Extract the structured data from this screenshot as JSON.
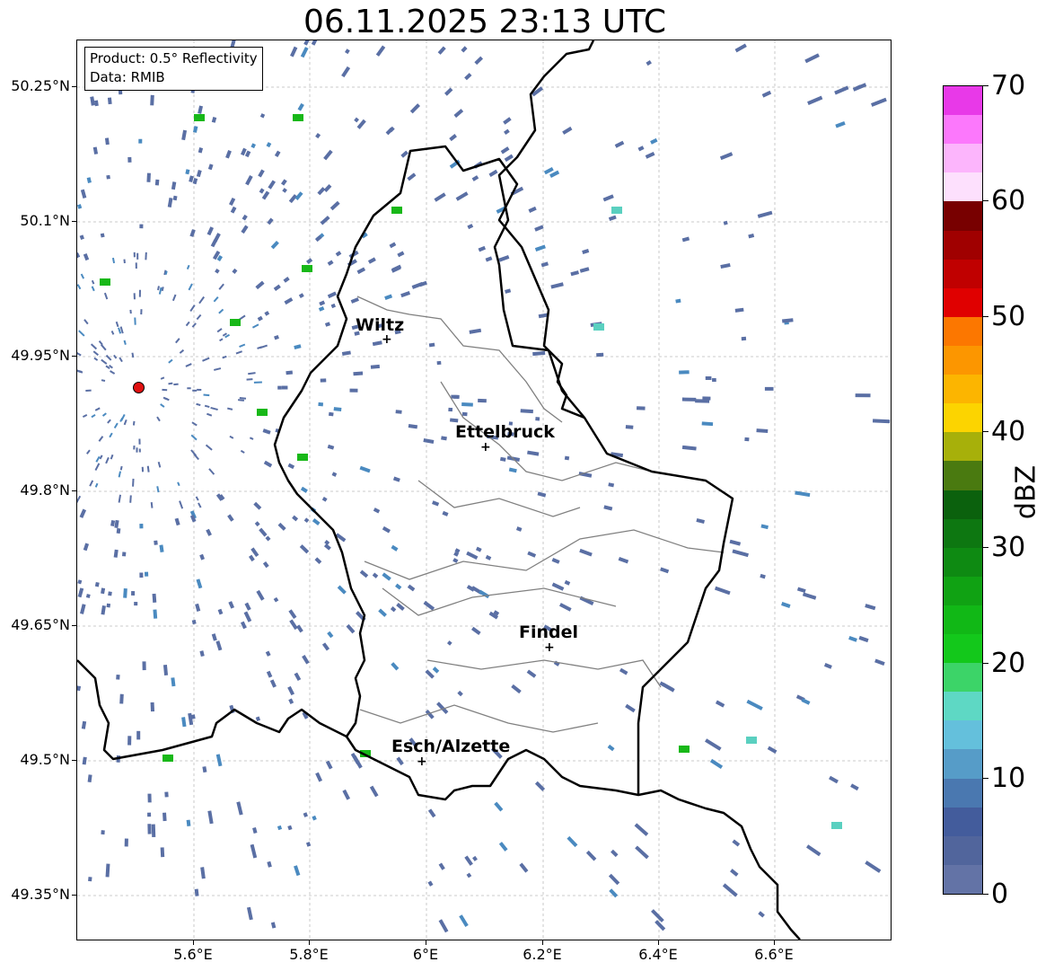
{
  "title": "06.11.2025 23:13 UTC",
  "info": {
    "product": "Product: 0.5° Reflectivity",
    "data": "Data: RMIB"
  },
  "axes": {
    "lat_labels": [
      "50.25°N",
      "50.1°N",
      "49.95°N",
      "49.8°N",
      "49.65°N",
      "49.5°N",
      "49.35°N"
    ],
    "lon_labels": [
      "5.6°E",
      "5.8°E",
      "6°E",
      "6.2°E",
      "6.4°E",
      "6.6°E"
    ]
  },
  "cities": [
    {
      "name": "Wiltz"
    },
    {
      "name": "Ettelbruck"
    },
    {
      "name": "Findel"
    },
    {
      "name": "Esch/Alzette"
    }
  ],
  "colorbar": {
    "unit": "dBZ",
    "ticks": [
      "0",
      "10",
      "20",
      "30",
      "40",
      "50",
      "60",
      "70"
    ],
    "colors": [
      "#6373a6",
      "#51659c",
      "#435c9c",
      "#4a78b0",
      "#569cc8",
      "#64c0dc",
      "#5ed8c4",
      "#3cd468",
      "#13c81b",
      "#11b816",
      "#10a213",
      "#0e8a12",
      "#0d7711",
      "#0b610d",
      "#4a7a10",
      "#a7b00a",
      "#fcd400",
      "#fcb500",
      "#fc9600",
      "#fc7700",
      "#e00000",
      "#c00000",
      "#a00000",
      "#780000",
      "#fde0fd",
      "#fcb5fc",
      "#fc78fc",
      "#e839e8"
    ]
  },
  "colors": {
    "radar_low": "#5a6fa4",
    "radar_mid": "#4a8ac0",
    "radar_teal": "#5ad0c0",
    "radar_green": "#18b818",
    "border": "#000000",
    "canton": "#808080",
    "grid": "#bbbbbb"
  }
}
